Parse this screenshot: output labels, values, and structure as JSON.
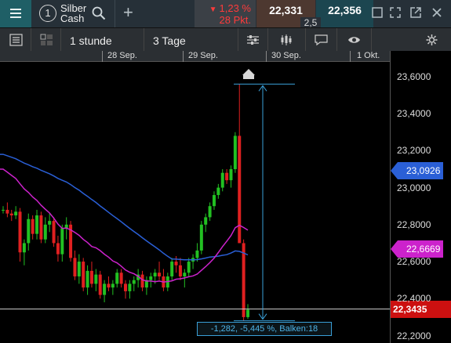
{
  "header": {
    "instrument_number": "1",
    "instrument_name": "Silber Cash",
    "change_percent": "1,23 %",
    "change_points": "28 Pkt.",
    "bid": "22,331",
    "ask": "22,356",
    "spread": "2,5",
    "colors": {
      "down": "#ff3b3b",
      "bid_bg": "#4d3830",
      "ask_bg": "#1c4650",
      "menu_bg": "#1f5f66"
    }
  },
  "toolbar": {
    "interval": "1 stunde",
    "range": "3 Tage"
  },
  "date_axis": [
    "28 Sep.",
    "29 Sep.",
    "30 Sep.",
    "1 Okt."
  ],
  "chart_data": {
    "type": "candlestick",
    "price_axis_ticks": [
      "23,6000",
      "23,4000",
      "23,2000",
      "23,0000",
      "22,8000",
      "22,6000",
      "22,4000",
      "22,2000"
    ],
    "ylim": [
      22.16,
      23.68
    ],
    "current_price": "22,3435",
    "current_price_value": 22.3435,
    "ma_blue_label": "23,0926",
    "ma_blue_value": 23.0926,
    "ma_magenta_label": "22,6669",
    "ma_magenta_value": 22.6669,
    "colors": {
      "up": "#22c022",
      "down": "#e02020",
      "ma_blue": "#2a5fd6",
      "ma_magenta": "#cc22cc",
      "measure": "#3aa0d8"
    },
    "candles": [
      [
        22.88,
        22.9,
        22.86,
        22.88
      ],
      [
        22.88,
        22.92,
        22.84,
        22.86
      ],
      [
        22.86,
        22.88,
        22.82,
        22.85
      ],
      [
        22.85,
        22.9,
        22.83,
        22.87
      ],
      [
        22.87,
        22.89,
        22.6,
        22.65
      ],
      [
        22.65,
        22.72,
        22.58,
        22.7
      ],
      [
        22.7,
        22.86,
        22.66,
        22.83
      ],
      [
        22.83,
        22.85,
        22.72,
        22.75
      ],
      [
        22.75,
        22.88,
        22.72,
        22.85
      ],
      [
        22.85,
        22.87,
        22.7,
        22.72
      ],
      [
        22.72,
        22.84,
        22.7,
        22.8
      ],
      [
        22.8,
        22.86,
        22.76,
        22.82
      ],
      [
        22.82,
        22.84,
        22.68,
        22.7
      ],
      [
        22.7,
        22.74,
        22.6,
        22.64
      ],
      [
        22.64,
        22.8,
        22.6,
        22.78
      ],
      [
        22.78,
        22.84,
        22.72,
        22.8
      ],
      [
        22.8,
        22.82,
        22.6,
        22.62
      ],
      [
        22.62,
        22.66,
        22.5,
        22.52
      ],
      [
        22.52,
        22.64,
        22.48,
        22.6
      ],
      [
        22.6,
        22.62,
        22.44,
        22.46
      ],
      [
        22.46,
        22.58,
        22.42,
        22.55
      ],
      [
        22.55,
        22.6,
        22.46,
        22.48
      ],
      [
        22.48,
        22.56,
        22.44,
        22.53
      ],
      [
        22.53,
        22.55,
        22.4,
        22.42
      ],
      [
        22.42,
        22.5,
        22.38,
        22.48
      ],
      [
        22.48,
        22.52,
        22.44,
        22.46
      ],
      [
        22.46,
        22.5,
        22.42,
        22.48
      ],
      [
        22.48,
        22.56,
        22.46,
        22.54
      ],
      [
        22.54,
        22.56,
        22.46,
        22.48
      ],
      [
        22.48,
        22.5,
        22.4,
        22.44
      ],
      [
        22.44,
        22.5,
        22.4,
        22.48
      ],
      [
        22.48,
        22.52,
        22.44,
        22.5
      ],
      [
        22.5,
        22.56,
        22.46,
        22.53
      ],
      [
        22.53,
        22.55,
        22.44,
        22.46
      ],
      [
        22.46,
        22.52,
        22.42,
        22.5
      ],
      [
        22.5,
        22.54,
        22.46,
        22.52
      ],
      [
        22.52,
        22.56,
        22.48,
        22.54
      ],
      [
        22.54,
        22.6,
        22.5,
        22.52
      ],
      [
        22.52,
        22.56,
        22.44,
        22.46
      ],
      [
        22.46,
        22.54,
        22.44,
        22.52
      ],
      [
        22.52,
        22.62,
        22.5,
        22.6
      ],
      [
        22.6,
        22.63,
        22.54,
        22.58
      ],
      [
        22.58,
        22.62,
        22.5,
        22.52
      ],
      [
        22.52,
        22.56,
        22.46,
        22.54
      ],
      [
        22.54,
        22.62,
        22.52,
        22.6
      ],
      [
        22.6,
        22.64,
        22.56,
        22.62
      ],
      [
        22.62,
        22.7,
        22.6,
        22.66
      ],
      [
        22.66,
        22.82,
        22.64,
        22.8
      ],
      [
        22.8,
        22.86,
        22.76,
        22.84
      ],
      [
        22.84,
        22.92,
        22.82,
        22.9
      ],
      [
        22.9,
        22.98,
        22.88,
        22.96
      ],
      [
        22.96,
        23.02,
        22.94,
        23.0
      ],
      [
        23.0,
        23.1,
        22.98,
        23.08
      ],
      [
        23.08,
        23.1,
        23.02,
        23.04
      ],
      [
        23.04,
        23.12,
        23.0,
        23.1
      ],
      [
        23.1,
        23.3,
        23.08,
        23.28
      ],
      [
        23.28,
        23.56,
        22.7,
        22.7
      ],
      [
        22.7,
        22.72,
        22.28,
        22.3
      ],
      [
        22.3,
        22.37,
        22.29,
        22.34
      ]
    ],
    "measurement": "-1,282, -5,445 %, Balken:18"
  }
}
